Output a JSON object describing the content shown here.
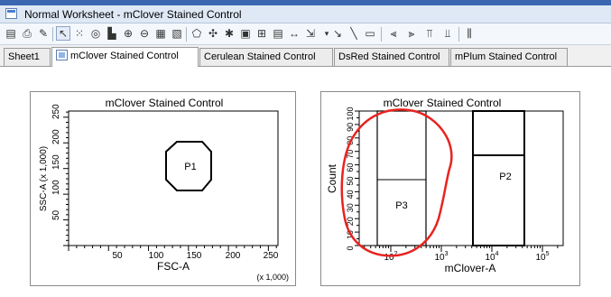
{
  "window": {
    "title": "Normal Worksheet - mClover Stained Control"
  },
  "tabs": [
    {
      "label": "Sheet1",
      "active": false
    },
    {
      "label": "mClover Stained Control",
      "active": true
    },
    {
      "label": "Cerulean Stained Control",
      "active": false
    },
    {
      "label": "DsRed Stained Control",
      "active": false
    },
    {
      "label": "mPlum Stained Control",
      "active": false
    }
  ],
  "plot1": {
    "title": "mClover Stained Control",
    "xlabel": "FSC-A",
    "ylabel": "SSC-A (x 1,000)",
    "x_unit": "(x 1,000)",
    "xticks": [
      "50",
      "100",
      "150",
      "200",
      "250"
    ],
    "yticks": [
      "50",
      "100",
      "150",
      "200",
      "250"
    ],
    "gate_label": "P1"
  },
  "plot2": {
    "title": "mClover Stained Control",
    "xlabel": "mClover-A",
    "ylabel": "Count",
    "xticks": [
      "10",
      "10",
      "10",
      "10"
    ],
    "xtick_exponents": [
      "2",
      "3",
      "4",
      "5"
    ],
    "yticks": [
      "0",
      "10",
      "20",
      "30",
      "40",
      "50",
      "60",
      "70",
      "80",
      "90",
      "100"
    ],
    "gates": [
      "P3",
      "P2"
    ]
  },
  "annotation": {
    "color": "#e8231f"
  },
  "colors": {
    "titlebar": "#dfe9f6",
    "accent": "#3a67b0"
  }
}
